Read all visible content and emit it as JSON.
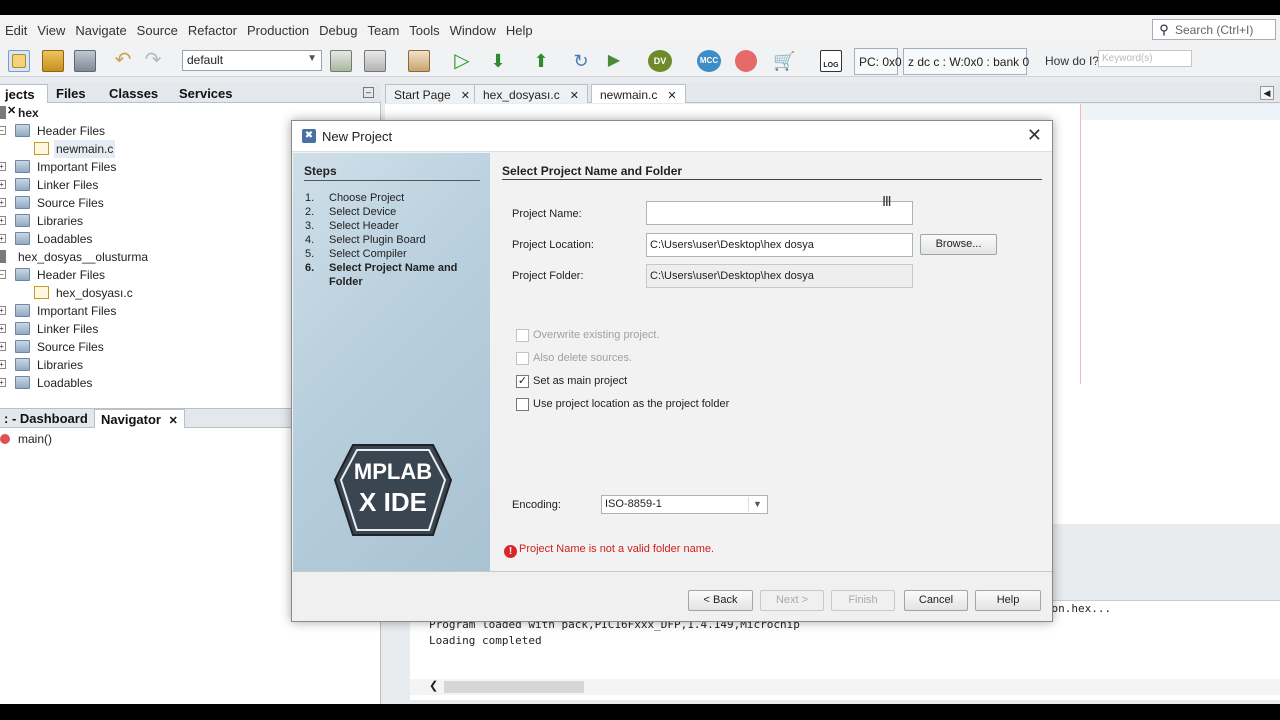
{
  "menu": [
    "Edit",
    "View",
    "Navigate",
    "Source",
    "Refactor",
    "Production",
    "Debug",
    "Team",
    "Tools",
    "Window",
    "Help"
  ],
  "search": {
    "placeholder": "Search (Ctrl+I)"
  },
  "toolbar": {
    "configuration": "default",
    "pc": "PC: 0x0",
    "status": "z dc c  : W:0x0 : bank 0",
    "how_do_i": "How do I?",
    "keyword_placeholder": "Keyword(s)",
    "icons": [
      "new-file-icon",
      "new-project-icon",
      "open-project-icon",
      "close-project-icon",
      "undo-icon",
      "redo-icon",
      "build-icon",
      "clean-build-icon",
      "make-project-icon",
      "run-icon",
      "debug-icon",
      "program-device-icon",
      "read-device-icon",
      "reset-icon",
      "hold-icon",
      "dv-icon",
      "mcc-icon",
      "ipe-icon",
      "cart-icon",
      "log-icon"
    ]
  },
  "projects_panel": {
    "tabs": [
      "jects",
      "Files",
      "Classes",
      "Services"
    ],
    "tree": [
      {
        "label": "hex",
        "level": 0,
        "type": "project"
      },
      {
        "label": "Header Files",
        "level": 1,
        "type": "folder"
      },
      {
        "label": "newmain.c",
        "level": 2,
        "type": "file"
      },
      {
        "label": "Important Files",
        "level": 1,
        "type": "folder"
      },
      {
        "label": "Linker Files",
        "level": 1,
        "type": "folder"
      },
      {
        "label": "Source Files",
        "level": 1,
        "type": "folder"
      },
      {
        "label": "Libraries",
        "level": 1,
        "type": "folder"
      },
      {
        "label": "Loadables",
        "level": 1,
        "type": "folder"
      },
      {
        "label": "hex_dosyas__olusturma",
        "level": 0,
        "type": "project"
      },
      {
        "label": "Header Files",
        "level": 1,
        "type": "folder"
      },
      {
        "label": "hex_dosyası.c",
        "level": 2,
        "type": "file"
      },
      {
        "label": "Important Files",
        "level": 1,
        "type": "folder"
      },
      {
        "label": "Linker Files",
        "level": 1,
        "type": "folder"
      },
      {
        "label": "Source Files",
        "level": 1,
        "type": "folder"
      },
      {
        "label": "Libraries",
        "level": 1,
        "type": "folder"
      },
      {
        "label": "Loadables",
        "level": 1,
        "type": "folder"
      }
    ]
  },
  "navigator_panel": {
    "tabs": [
      ": - Dashboard",
      "Navigator"
    ],
    "item": "main()"
  },
  "editor_tabs": [
    "Start Page",
    "hex_dosyası.c",
    "newmain.c"
  ],
  "output": {
    "lines": [
      "Loading code from C:/Users/user/Desktop/hex dosya/hex.X/dist/default/production/hex.X.production.hex...",
      "Program loaded with pack,PIC16Fxxx_DFP,1.4.149,Microchip",
      "Loading completed"
    ]
  },
  "dialog": {
    "title": "New Project",
    "steps_heading": "Steps",
    "steps": [
      {
        "n": "1.",
        "label": "Choose Project"
      },
      {
        "n": "2.",
        "label": "Select Device"
      },
      {
        "n": "3.",
        "label": "Select Header"
      },
      {
        "n": "4.",
        "label": "Select Plugin Board"
      },
      {
        "n": "5.",
        "label": "Select Compiler"
      },
      {
        "n": "6.",
        "label": "Select Project Name and Folder"
      }
    ],
    "logo_top": "MPLAB",
    "logo_bottom": "X IDE",
    "heading": "Select Project Name and Folder",
    "project_name_label": "Project Name:",
    "project_name_value": "",
    "project_location_label": "Project Location:",
    "project_location_value": "C:\\Users\\user\\Desktop\\hex dosya",
    "project_folder_label": "Project Folder:",
    "project_folder_value": "C:\\Users\\user\\Desktop\\hex dosya",
    "browse": "Browse...",
    "overwrite": "Overwrite existing project.",
    "also_delete": "Also delete sources.",
    "set_main": "Set as main project",
    "use_location": "Use project location as the project folder",
    "encoding_label": "Encoding:",
    "encoding_value": "ISO-8859-1",
    "error": "Project Name is not a valid folder name.",
    "buttons": {
      "back": "< Back",
      "next": "Next >",
      "finish": "Finish",
      "cancel": "Cancel",
      "help": "Help"
    }
  }
}
